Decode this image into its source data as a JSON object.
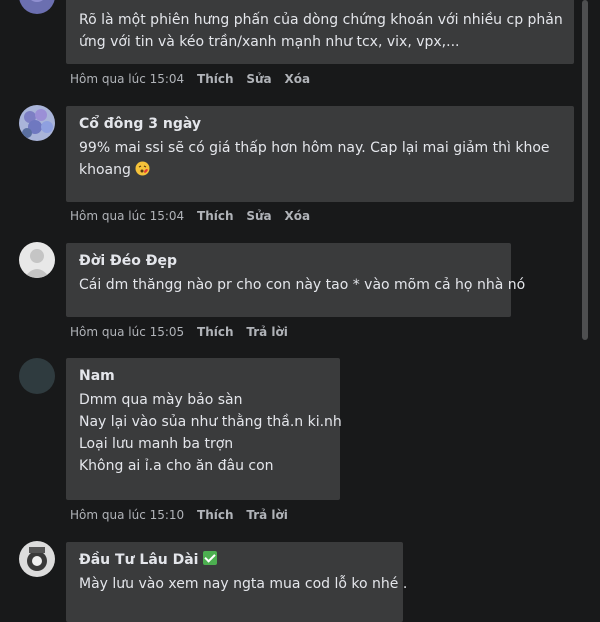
{
  "comments": [
    {
      "author": "",
      "lines": [
        "Rõ là một phiên hưng phấn của dòng chứng khoán với nhiều cp phản",
        "ứng với tin và kéo trần/xanh mạnh như tcx, vix, vpx,..."
      ],
      "time": "Hôm qua lúc 15:04",
      "actions": [
        "Thích",
        "Sửa",
        "Xóa"
      ]
    },
    {
      "author": "Cổ đông 3 ngày",
      "lines": [
        "99% mai ssi sẽ có giá thấp hơn hôm nay. Cap lại mai giảm thì khoe",
        "khoang"
      ],
      "emoji": "face-blowing-kiss-emoji",
      "time": "Hôm qua lúc 15:04",
      "actions": [
        "Thích",
        "Sửa",
        "Xóa"
      ]
    },
    {
      "author": "Đời Đéo Đẹp",
      "lines": [
        "Cái dm thăngg nào pr cho con này tao * vào mõm cả họ nhà nó"
      ],
      "time": "Hôm qua lúc 15:05",
      "actions": [
        "Thích",
        "Trả lời"
      ]
    },
    {
      "author": "Nam",
      "lines": [
        "Dmm qua mày bảo sàn",
        "Nay lại vào sủa như thằng thầ.n ki.nh",
        "Loại lưu manh ba trợn",
        "Không ai ỉ.a cho ăn đâu con"
      ],
      "time": "Hôm qua lúc 15:10",
      "actions": [
        "Thích",
        "Trả lời"
      ]
    },
    {
      "author": "Đầu Tư Lâu Dài",
      "badge": "check-mark-icon",
      "lines": [
        "Mày lưu vào xem nay ngta mua cod lỗ ko nhé ."
      ],
      "time": "",
      "actions": []
    }
  ]
}
